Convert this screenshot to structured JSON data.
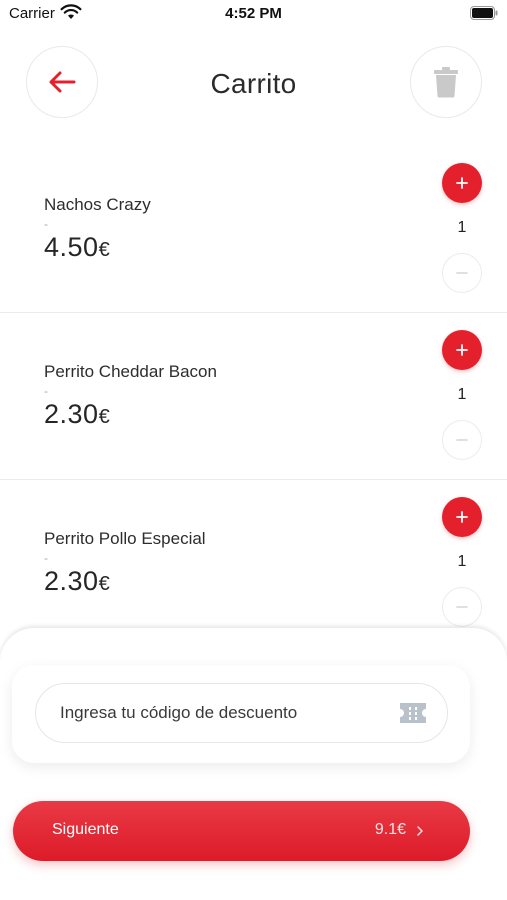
{
  "status_bar": {
    "carrier": "Carrier",
    "time": "4:52 PM"
  },
  "header": {
    "title": "Carrito",
    "back_icon": "arrow-left-icon",
    "delete_icon": "trash-icon"
  },
  "cart": {
    "items": [
      {
        "name": "Nachos Crazy",
        "description": "-",
        "price": "4.50",
        "currency": "€",
        "quantity": "1"
      },
      {
        "name": "Perrito Cheddar Bacon",
        "description": "-",
        "price": "2.30",
        "currency": "€",
        "quantity": "1"
      },
      {
        "name": "Perrito Pollo Especial",
        "description": "-",
        "price": "2.30",
        "currency": "€",
        "quantity": "1"
      }
    ]
  },
  "discount": {
    "placeholder": "Ingresa tu código de descuento",
    "icon": "ticket-icon"
  },
  "footer": {
    "next_label": "Siguiente",
    "total": "9.1€"
  },
  "colors": {
    "accent": "#e4202d",
    "muted_icon": "#c9c9c9"
  }
}
